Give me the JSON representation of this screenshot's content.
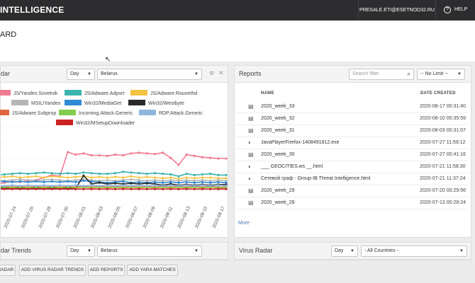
{
  "header": {
    "brand": "INTELLIGENCE",
    "user_email": "PRESALE.ETI@ESETNOD32.RU",
    "help_label": "HELP"
  },
  "page": {
    "title": "ARD"
  },
  "left_panel": {
    "title": "dar",
    "period": "Day",
    "country": "Belarus",
    "legend": [
      {
        "name": "JS/Yandex.Sovetnik",
        "color": "#f07a8f"
      },
      {
        "name": "JS/Adware.Adport",
        "color": "#3bb4ae"
      },
      {
        "name": "JS/Adware.Rounethd",
        "color": "#f5c344"
      },
      {
        "name": "MSIL/Yandex",
        "color": "#b5b5b5"
      },
      {
        "name": "Win32/MediaGet",
        "color": "#2d8ad4"
      },
      {
        "name": "Win32/Westbyte",
        "color": "#2a2a2a"
      },
      {
        "name": "JS/Adware.Subprop",
        "color": "#e0663e"
      },
      {
        "name": "Incoming.Attack.Generic",
        "color": "#82cc4e"
      },
      {
        "name": "RDP.Attack.Generic",
        "color": "#8fb6dc"
      },
      {
        "name": "Win32/MSetupDownloader",
        "color": "#cc2222"
      }
    ],
    "x_ticks": [
      "2020-07-24",
      "2020-07-26",
      "2020-07-28",
      "2020-07-30",
      "2020-08-01",
      "2020-08-03",
      "2020-08-05",
      "2020-08-07",
      "2020-08-09",
      "2020-08-11",
      "2020-08-13",
      "2020-08-15",
      "2020-08-17"
    ]
  },
  "reports": {
    "title": "Reports",
    "search_placeholder": "Search filter",
    "limit": "-- No Limit --",
    "col_name": "NAME",
    "col_date": "DATE CREATED",
    "rows": [
      {
        "icon": "doc",
        "name": "2020_week_33",
        "date": "2020-08-17 00:31:40"
      },
      {
        "icon": "doc",
        "name": "2020_week_32",
        "date": "2020-08-10 00:35:59"
      },
      {
        "icon": "doc",
        "name": "2020_week_31",
        "date": "2020-08-03 00:31:07"
      },
      {
        "icon": "shield",
        "name": "JavaPlayerFirefox-1408491812.exe",
        "date": "2020-07-27 11:59:12"
      },
      {
        "icon": "doc",
        "name": "2020_week_30",
        "date": "2020-07-27 00:41:16"
      },
      {
        "icon": "shield",
        "name": "___ GEOCITIES.ws __.html",
        "date": "2020-07-21 11:58:30"
      },
      {
        "icon": "shield",
        "name": "Сетевой граф - Group-IB Threat Intelligence.html",
        "date": "2020-07-21 11:37:24"
      },
      {
        "icon": "doc",
        "name": "2020_week_29",
        "date": "2020-07-20 00:29:56"
      },
      {
        "icon": "doc",
        "name": "2020_week_28",
        "date": "2020-07-13 00:28:24"
      }
    ],
    "more_label": "More"
  },
  "bottom_left": {
    "title": "dar Trends",
    "period": "Day",
    "country": "Belarus"
  },
  "bottom_right": {
    "title": "Virus Radar",
    "period": "Day",
    "country": "- All Countries -"
  },
  "buttons": [
    {
      "label": "RADAR"
    },
    {
      "label": "ADD VIRUS RADAR TRENDS"
    },
    {
      "label": "ADD REPORTS"
    },
    {
      "label": "ADD YARA MATCHES"
    }
  ],
  "chart_data": {
    "type": "line",
    "x": [
      "2020-07-20",
      "2020-07-21",
      "2020-07-22",
      "2020-07-23",
      "2020-07-24",
      "2020-07-25",
      "2020-07-26",
      "2020-07-27",
      "2020-07-28",
      "2020-07-29",
      "2020-07-30",
      "2020-07-31",
      "2020-08-01",
      "2020-08-02",
      "2020-08-03",
      "2020-08-04",
      "2020-08-05",
      "2020-08-06",
      "2020-08-07",
      "2020-08-08",
      "2020-08-09",
      "2020-08-10",
      "2020-08-11",
      "2020-08-12",
      "2020-08-13",
      "2020-08-14",
      "2020-08-15",
      "2020-08-16",
      "2020-08-17",
      "2020-08-18"
    ],
    "ylim": [
      0,
      100
    ],
    "series": [
      {
        "name": "JS/Yandex.Sovetnik",
        "values": [
          10,
          12,
          14,
          13,
          15,
          16,
          20,
          24,
          22,
          60,
          56,
          58,
          55,
          55,
          54,
          56,
          55,
          58,
          59,
          58,
          57,
          59,
          51,
          40,
          56,
          54,
          52,
          51,
          50,
          50
        ]
      },
      {
        "name": "JS/Adware.Adport",
        "values": [
          24,
          25,
          26,
          27,
          26,
          27,
          28,
          27,
          26,
          27,
          26,
          28,
          27,
          26,
          26,
          27,
          29,
          28,
          27,
          26,
          27,
          26,
          25,
          22,
          26,
          24,
          25,
          26,
          24,
          24
        ]
      },
      {
        "name": "JS/Adware.Rounethd",
        "values": [
          20,
          21,
          22,
          20,
          21,
          22,
          20,
          22,
          21,
          20,
          21,
          22,
          20,
          21,
          20,
          21,
          20,
          22,
          20,
          21,
          20,
          19,
          20,
          18,
          20,
          19,
          20,
          20,
          19,
          19
        ]
      },
      {
        "name": "MSIL/Yandex",
        "values": [
          16,
          15,
          16,
          17,
          16,
          15,
          16,
          17,
          16,
          15,
          16,
          17,
          16,
          15,
          16,
          15,
          16,
          17,
          16,
          15,
          16,
          15,
          16,
          15,
          16,
          15,
          16,
          15,
          16,
          15
        ]
      },
      {
        "name": "Win32/MediaGet",
        "values": [
          14,
          14,
          13,
          14,
          13,
          14,
          13,
          14,
          13,
          14,
          13,
          15,
          14,
          13,
          12,
          13,
          14,
          12,
          13,
          12,
          13,
          12,
          13,
          12,
          13,
          12,
          13,
          12,
          13,
          12
        ]
      },
      {
        "name": "Win32/Westbyte",
        "values": [
          3,
          3,
          3,
          4,
          3,
          3,
          3,
          4,
          3,
          3,
          3,
          23,
          10,
          12,
          10,
          11,
          10,
          11,
          10,
          11,
          10,
          8,
          10,
          8,
          9,
          8,
          9,
          8,
          9,
          9
        ]
      },
      {
        "name": "JS/Adware.Subprop",
        "values": [
          6,
          6,
          5,
          6,
          5,
          6,
          5,
          6,
          5,
          6,
          5,
          6,
          5,
          6,
          5,
          6,
          5,
          6,
          5,
          6,
          5,
          6,
          5,
          6,
          5,
          6,
          5,
          6,
          5,
          5
        ]
      },
      {
        "name": "Incoming.Attack.Generic",
        "values": [
          4,
          5,
          4,
          5,
          4,
          5,
          4,
          5,
          4,
          5,
          4,
          5,
          4,
          5,
          4,
          5,
          4,
          5,
          4,
          5,
          4,
          5,
          4,
          5,
          4,
          5,
          4,
          5,
          4,
          4
        ]
      },
      {
        "name": "RDP.Attack.Generic",
        "values": [
          7,
          7,
          8,
          7,
          8,
          7,
          8,
          7,
          8,
          7,
          8,
          7,
          8,
          7,
          8,
          7,
          8,
          7,
          8,
          7,
          8,
          7,
          8,
          7,
          8,
          7,
          8,
          7,
          8,
          7
        ]
      },
      {
        "name": "Win32/MSetupDownloader",
        "values": [
          2,
          2,
          2,
          2,
          2,
          2,
          2,
          2,
          2,
          2,
          2,
          2,
          2,
          2,
          2,
          2,
          2,
          2,
          2,
          2,
          2,
          2,
          2,
          2,
          2,
          2,
          2,
          2,
          2,
          2
        ]
      }
    ]
  }
}
